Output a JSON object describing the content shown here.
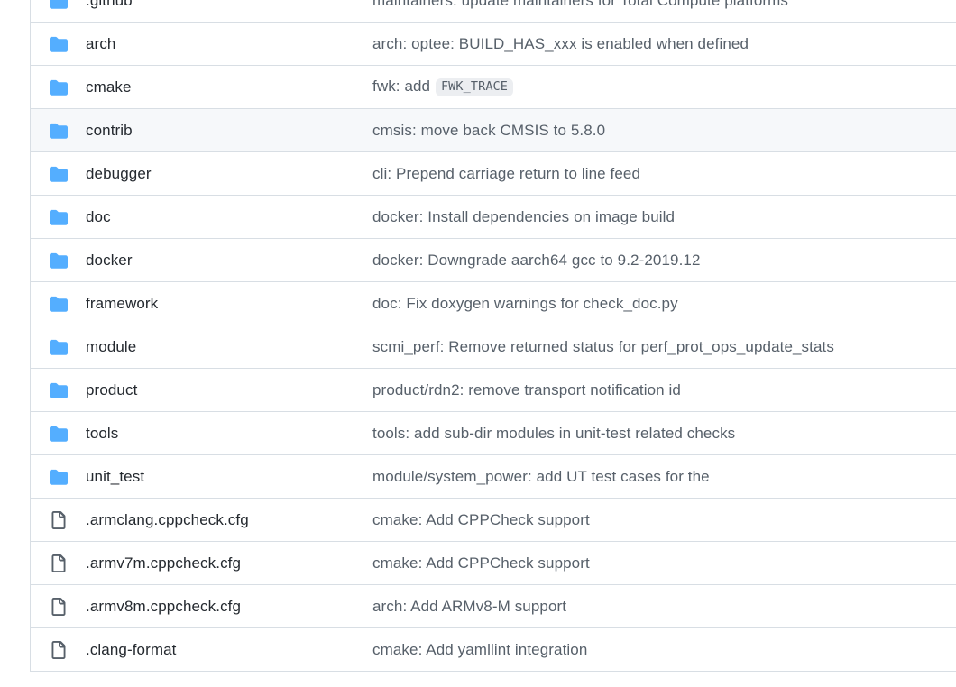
{
  "listing": {
    "icon_names": {
      "folder": "folder-icon",
      "file": "file-icon"
    },
    "colors": {
      "folder_icon": "#54aeff",
      "file_icon": "#57606a",
      "name_text": "#24292f",
      "commit_text": "#57606a",
      "row_border": "#d8dee4",
      "row_highlight_bg": "#f6f8fa",
      "page_bg": "#ffffff"
    },
    "rows": [
      {
        "type": "folder",
        "name": ".github",
        "commit": "maintainers: update maintainers for Total Compute platforms",
        "highlighted": false
      },
      {
        "type": "folder",
        "name": "arch",
        "commit": "arch: optee: BUILD_HAS_xxx is enabled when defined",
        "highlighted": false
      },
      {
        "type": "folder",
        "name": "cmake",
        "commit_prefix": "fwk: add",
        "commit_code": "FWK_TRACE",
        "commit": "fwk: add FWK_TRACE",
        "highlighted": false
      },
      {
        "type": "folder",
        "name": "contrib",
        "commit": "cmsis: move back CMSIS to 5.8.0",
        "highlighted": true
      },
      {
        "type": "folder",
        "name": "debugger",
        "commit": "cli: Prepend carriage return to line feed",
        "highlighted": false
      },
      {
        "type": "folder",
        "name": "doc",
        "commit": "docker: Install dependencies on image build",
        "highlighted": false
      },
      {
        "type": "folder",
        "name": "docker",
        "commit": "docker: Downgrade aarch64 gcc to 9.2-2019.12",
        "highlighted": false
      },
      {
        "type": "folder",
        "name": "framework",
        "commit": "doc: Fix doxygen warnings for check_doc.py",
        "highlighted": false
      },
      {
        "type": "folder",
        "name": "module",
        "commit": "scmi_perf: Remove returned status for perf_prot_ops_update_stats",
        "highlighted": false
      },
      {
        "type": "folder",
        "name": "product",
        "commit": "product/rdn2: remove transport notification id",
        "highlighted": false
      },
      {
        "type": "folder",
        "name": "tools",
        "commit": "tools: add sub-dir modules in unit-test related checks",
        "highlighted": false
      },
      {
        "type": "folder",
        "name": "unit_test",
        "commit": "module/system_power: add UT test cases for the",
        "highlighted": false
      },
      {
        "type": "file",
        "name": ".armclang.cppcheck.cfg",
        "commit": "cmake: Add CPPCheck support",
        "highlighted": false
      },
      {
        "type": "file",
        "name": ".armv7m.cppcheck.cfg",
        "commit": "cmake: Add CPPCheck support",
        "highlighted": false
      },
      {
        "type": "file",
        "name": ".armv8m.cppcheck.cfg",
        "commit": "arch: Add ARMv8-M support",
        "highlighted": false
      },
      {
        "type": "file",
        "name": ".clang-format",
        "commit": "cmake: Add yamllint integration",
        "highlighted": false
      }
    ]
  }
}
